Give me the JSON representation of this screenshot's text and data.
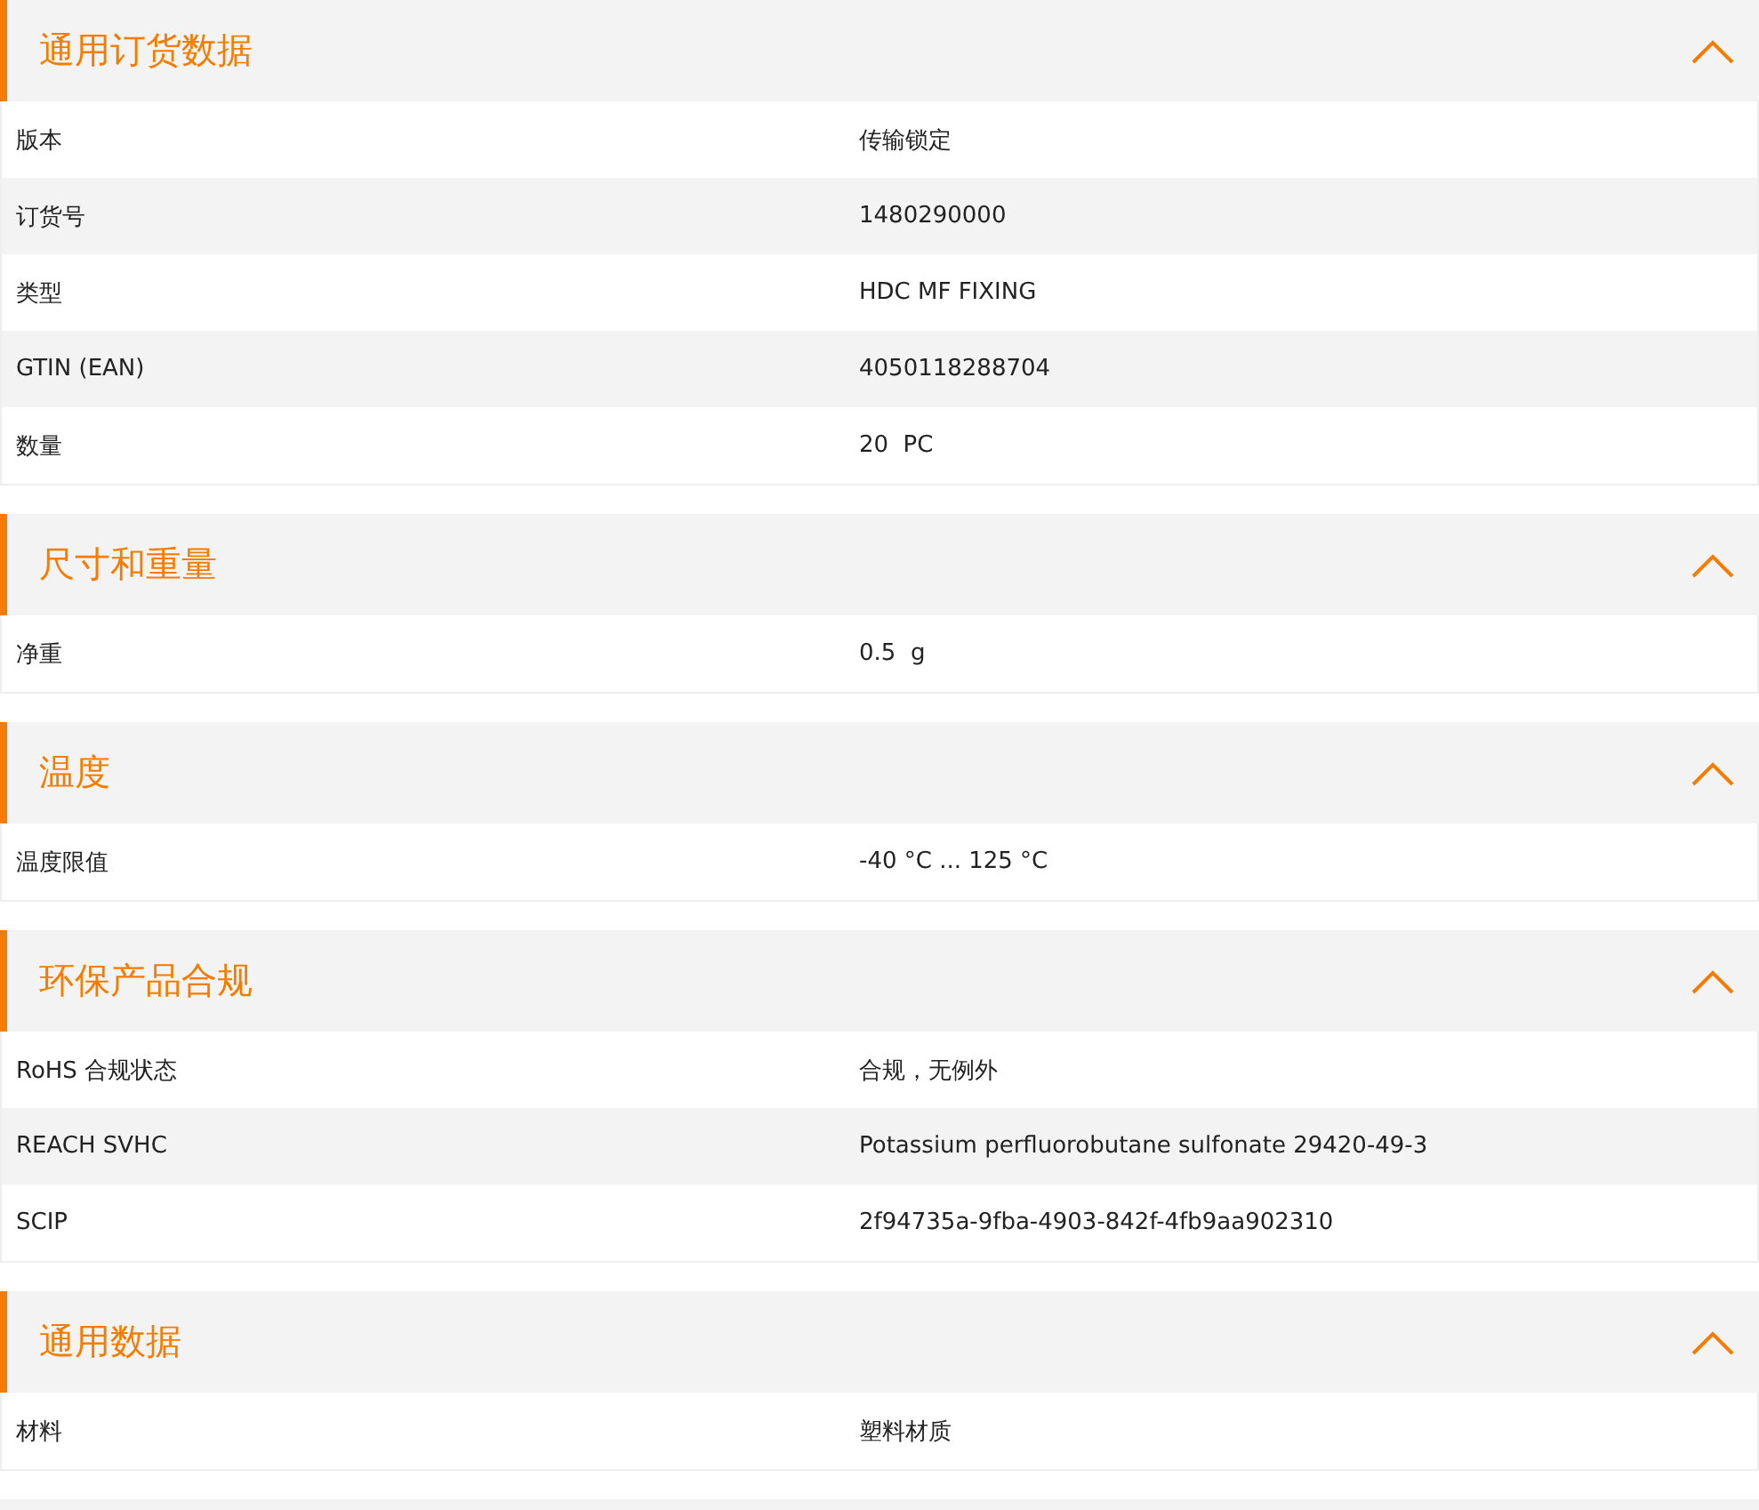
{
  "sections": [
    {
      "title": "通用订货数据",
      "expanded": true,
      "rows": [
        {
          "label": "版本",
          "value": "传输锁定"
        },
        {
          "label": "订货号",
          "value": "1480290000"
        },
        {
          "label": "类型",
          "value": "HDC MF FIXING"
        },
        {
          "label": "GTIN (EAN)",
          "value": "4050118288704"
        },
        {
          "label": "数量",
          "value": "20  PC"
        }
      ]
    },
    {
      "title": "尺寸和重量",
      "expanded": true,
      "rows": [
        {
          "label": "净重",
          "value": "0.5  g"
        }
      ]
    },
    {
      "title": "温度",
      "expanded": true,
      "rows": [
        {
          "label": "温度限值",
          "value": "-40 °C ... 125 °C"
        }
      ]
    },
    {
      "title": "环保产品合规",
      "expanded": true,
      "rows": [
        {
          "label": "RoHS 合规状态",
          "value": "合规，无例外"
        },
        {
          "label": "REACH SVHC",
          "value": "Potassium perfluorobutane sulfonate 29420-49-3"
        },
        {
          "label": "SCIP",
          "value": "2f94735a-9fba-4903-842f-4fb9aa902310"
        }
      ]
    },
    {
      "title": "通用数据",
      "expanded": true,
      "rows": [
        {
          "label": "材料",
          "value": "塑料材质"
        }
      ]
    }
  ]
}
